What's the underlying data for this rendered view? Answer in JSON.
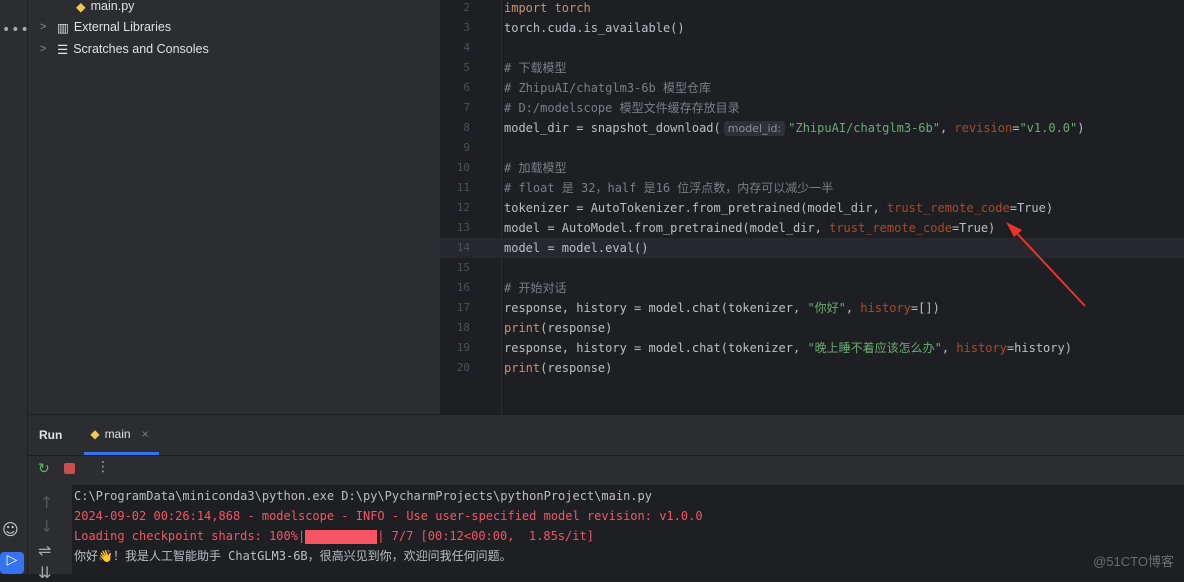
{
  "project": {
    "items": [
      {
        "label": "main.py",
        "icon": "python-file-icon"
      },
      {
        "label": "External Libraries",
        "icon": "library-icon"
      },
      {
        "label": "Scratches and Consoles",
        "icon": "scratches-icon"
      }
    ]
  },
  "editor": {
    "current_line": 14,
    "lines": [
      {
        "n": "2",
        "segs": [
          [
            "import torch",
            "k"
          ]
        ]
      },
      {
        "n": "3",
        "segs": [
          [
            "torch.cuda.is_available()",
            "f"
          ]
        ]
      },
      {
        "n": "4",
        "segs": []
      },
      {
        "n": "5",
        "segs": [
          [
            "# 下载模型",
            "c"
          ]
        ]
      },
      {
        "n": "6",
        "segs": [
          [
            "# ZhipuAI/chatglm3-6b 模型仓库",
            "c"
          ]
        ]
      },
      {
        "n": "7",
        "segs": [
          [
            "# D:/modelscope 模型文件缓存存放目录",
            "c"
          ]
        ]
      },
      {
        "n": "8",
        "segs": [
          [
            "model_dir = snapshot_download(",
            "f"
          ],
          [
            "model_id:",
            "hint"
          ],
          [
            "\"ZhipuAI/chatglm3-6b\"",
            "s"
          ],
          [
            ", ",
            "f"
          ],
          [
            "revision",
            "p"
          ],
          [
            "=",
            "f"
          ],
          [
            "\"v1.0.0\"",
            "s"
          ],
          [
            ")",
            "f"
          ]
        ]
      },
      {
        "n": "9",
        "segs": []
      },
      {
        "n": "10",
        "segs": [
          [
            "# 加载模型",
            "c"
          ]
        ]
      },
      {
        "n": "11",
        "segs": [
          [
            "# float 是 32，half 是16 位浮点数，内存可以减少一半",
            "c"
          ]
        ]
      },
      {
        "n": "12",
        "segs": [
          [
            "tokenizer = AutoTokenizer.from_pretrained(model_dir, ",
            "f"
          ],
          [
            "trust_remote_code",
            "p"
          ],
          [
            "=True)",
            "f"
          ]
        ]
      },
      {
        "n": "13",
        "segs": [
          [
            "model = AutoModel.from_pretrained(model_dir, ",
            "f"
          ],
          [
            "trust_remote_code",
            "p"
          ],
          [
            "=True)",
            "f"
          ]
        ]
      },
      {
        "n": "14",
        "segs": [
          [
            "model = model.eval()",
            "f"
          ]
        ]
      },
      {
        "n": "15",
        "segs": []
      },
      {
        "n": "16",
        "segs": [
          [
            "# 开始对话",
            "c"
          ]
        ]
      },
      {
        "n": "17",
        "segs": [
          [
            "response, history = model.chat(tokenizer, ",
            "f"
          ],
          [
            "\"你好\"",
            "s"
          ],
          [
            ", ",
            "f"
          ],
          [
            "history",
            "p"
          ],
          [
            "=[])",
            "f"
          ]
        ]
      },
      {
        "n": "18",
        "segs": [
          [
            "print",
            "k"
          ],
          [
            "(response)",
            "f"
          ]
        ]
      },
      {
        "n": "19",
        "segs": [
          [
            "response, history = model.chat(tokenizer, ",
            "f"
          ],
          [
            "\"晚上睡不着应该怎么办\"",
            "s"
          ],
          [
            ", ",
            "f"
          ],
          [
            "history",
            "p"
          ],
          [
            "=history)",
            "f"
          ]
        ]
      },
      {
        "n": "20",
        "segs": [
          [
            "print",
            "k"
          ],
          [
            "(response)",
            "f"
          ]
        ]
      }
    ]
  },
  "run": {
    "title": "Run",
    "tab": "main",
    "console": {
      "cmd": "C:\\ProgramData\\miniconda3\\python.exe D:\\py\\PycharmProjects\\pythonProject\\main.py",
      "info": "2024-09-02 00:26:14,868 - modelscope - INFO - Use user-specified model revision: v1.0.0",
      "progress_prefix": "Loading checkpoint shards: 100%|",
      "progress_suffix": "| 7/7 [00:12<00:00,  1.85s/it]",
      "progress": 100,
      "response": "你好👋！我是人工智能助手 ChatGLM3-6B，很高兴见到你，欢迎问我任何问题。"
    }
  },
  "watermark": "@51CTO博客",
  "colors": {
    "accent": "#3574f0",
    "error": "#f75464",
    "annotation_arrow": "#e8342a"
  }
}
